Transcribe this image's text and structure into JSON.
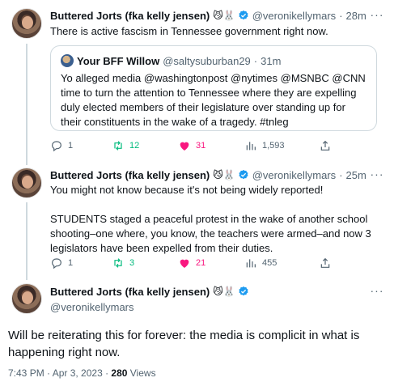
{
  "tweets": [
    {
      "name": "Buttered Jorts (fka kelly jensen)",
      "emoji": "😼🐰",
      "handle": "@veronikellymars",
      "dot": "·",
      "time": "28m",
      "text": "There is active fascism in Tennessee government right now.",
      "quote": {
        "name": "Your BFF Willow",
        "handle": "@saltysuburban29",
        "dot": "·",
        "time": "31m",
        "text": "Yo alleged media @washingtonpost @nytimes @MSNBC @CNN time to turn the attention to Tennessee where they are expelling duly elected members of their legislature over standing up for their constituents in the wake of a tragedy. #tnleg"
      },
      "replies": "1",
      "retweets": "12",
      "likes": "31",
      "views": "1,593"
    },
    {
      "name": "Buttered Jorts (fka kelly jensen)",
      "emoji": "😼🐰",
      "handle": "@veronikellymars",
      "dot": "·",
      "time": "25m",
      "text": "You might not know because it's not being widely reported!\n\nSTUDENTS staged a peaceful protest in the wake of another school shooting–one where, you know, the teachers were armed–and now 3 legislators have been expelled from their duties.",
      "replies": "1",
      "retweets": "3",
      "likes": "21",
      "views": "455"
    }
  ],
  "main": {
    "name": "Buttered Jorts (fka kelly jensen)",
    "emoji": "😼🐰",
    "handle": "@veronikellymars",
    "text": "Will be reiterating this for forever: the media is complicit in what is happening right now.",
    "timestamp": "7:43 PM · Apr 3, 2023 · ",
    "views_count": "280",
    "views_label": " Views"
  },
  "icons": {
    "more": "more-icon",
    "reply": "reply-icon",
    "retweet": "retweet-icon",
    "like": "heart-icon",
    "views": "views-icon",
    "share": "share-icon",
    "verified": "verified-badge-icon"
  },
  "colors": {
    "retweet": "#00ba7c",
    "like": "#f91880",
    "verified": "#1d9bf0",
    "secondary_text": "#536471"
  }
}
